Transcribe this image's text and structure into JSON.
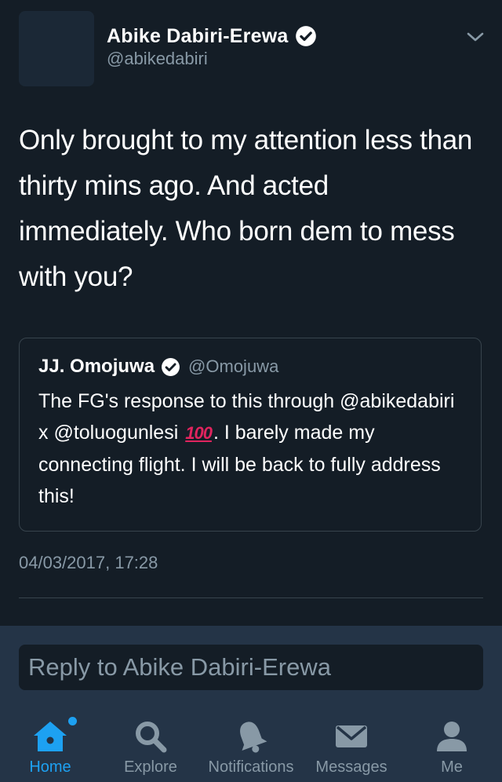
{
  "tweet": {
    "author_name": "Abike Dabiri-Erewa",
    "author_handle": "@abikedabiri",
    "text": "Only brought to my attention less than thirty mins ago. And acted immediately. Who born dem to mess with you?",
    "timestamp": "04/03/2017, 17:28",
    "verified": true
  },
  "quoted_tweet": {
    "author_name": "JJ. Omojuwa",
    "author_handle": "@Omojuwa",
    "text_before_emoji": "The FG's response to this through @abikedabiri x @toluogunlesi",
    "emoji": "💯",
    "emoji_text": "100",
    "text_after_emoji": ". I barely made my connecting flight. I will be back to fully address this!",
    "verified": true
  },
  "reply": {
    "placeholder": "Reply to Abike Dabiri-Erewa"
  },
  "tabs": [
    {
      "label": "Home",
      "icon": "home-icon",
      "active": true,
      "has_dot": true
    },
    {
      "label": "Explore",
      "icon": "search-icon",
      "active": false
    },
    {
      "label": "Notifications",
      "icon": "bell-icon",
      "active": false
    },
    {
      "label": "Messages",
      "icon": "envelope-icon",
      "active": false
    },
    {
      "label": "Me",
      "icon": "person-icon",
      "active": false
    }
  ],
  "colors": {
    "background": "#141d26",
    "bar_background": "#243447",
    "accent": "#1da1f2",
    "secondary_text": "#8899a6",
    "border": "#38444d"
  }
}
